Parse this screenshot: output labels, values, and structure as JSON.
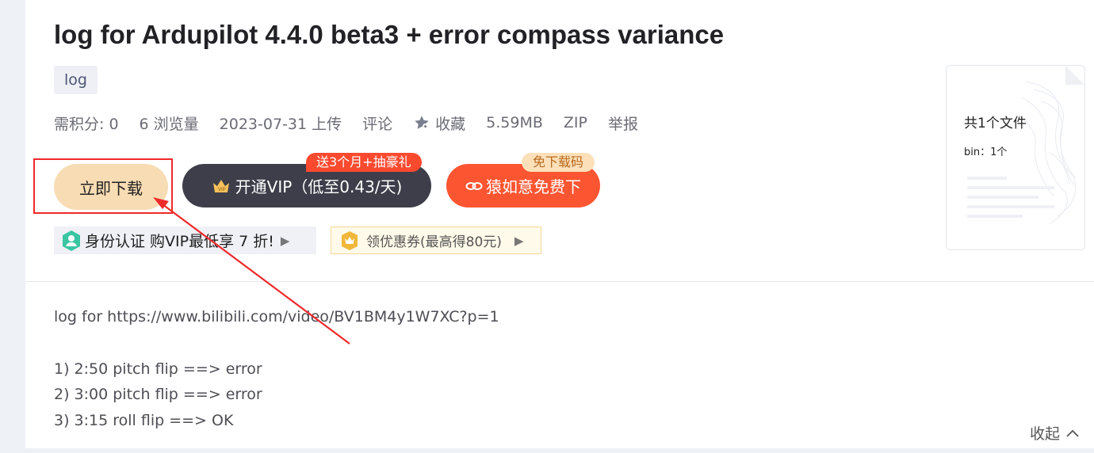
{
  "title": "log for Ardupilot 4.4.0 beta3 + error compass variance",
  "tag": "log",
  "meta": {
    "points": "需积分: 0",
    "views": "6 浏览量",
    "upload": "2023-07-31 上传",
    "comment": "评论",
    "favorite": "收藏",
    "size": "5.59MB",
    "format": "ZIP",
    "report": "举报"
  },
  "buttons": {
    "download": "立即下载",
    "vip": "开通VIP（低至0.43/天)",
    "vip_badge": "送3个月+抽豪礼",
    "free": "猿如意免费下",
    "free_badge": "免下载码"
  },
  "promos": {
    "identity": "身份认证 购VIP最低享 7 折!",
    "coupon": "领优惠券(最高得80元)"
  },
  "file_card": {
    "count": "共1个文件",
    "detail": "bin：1个"
  },
  "description": {
    "lines": [
      "log for https://www.bilibili.com/video/BV1BM4y1W7XC?p=1",
      "",
      "1) 2:50 pitch flip ==> error",
      "2) 3:00 pitch flip ==> error",
      "3) 3:15 roll flip ==> OK"
    ]
  },
  "collapse_label": "收起",
  "colors": {
    "download_bg": "#f8dcb3",
    "vip_bg": "#3d3e4a",
    "free_bg": "#fc5531",
    "annotation_red": "#ee2a2a"
  },
  "icons": [
    "star-icon",
    "crown-icon",
    "link-icon",
    "identity-icon",
    "coupon-icon",
    "play-icon",
    "chevron-up-icon"
  ]
}
